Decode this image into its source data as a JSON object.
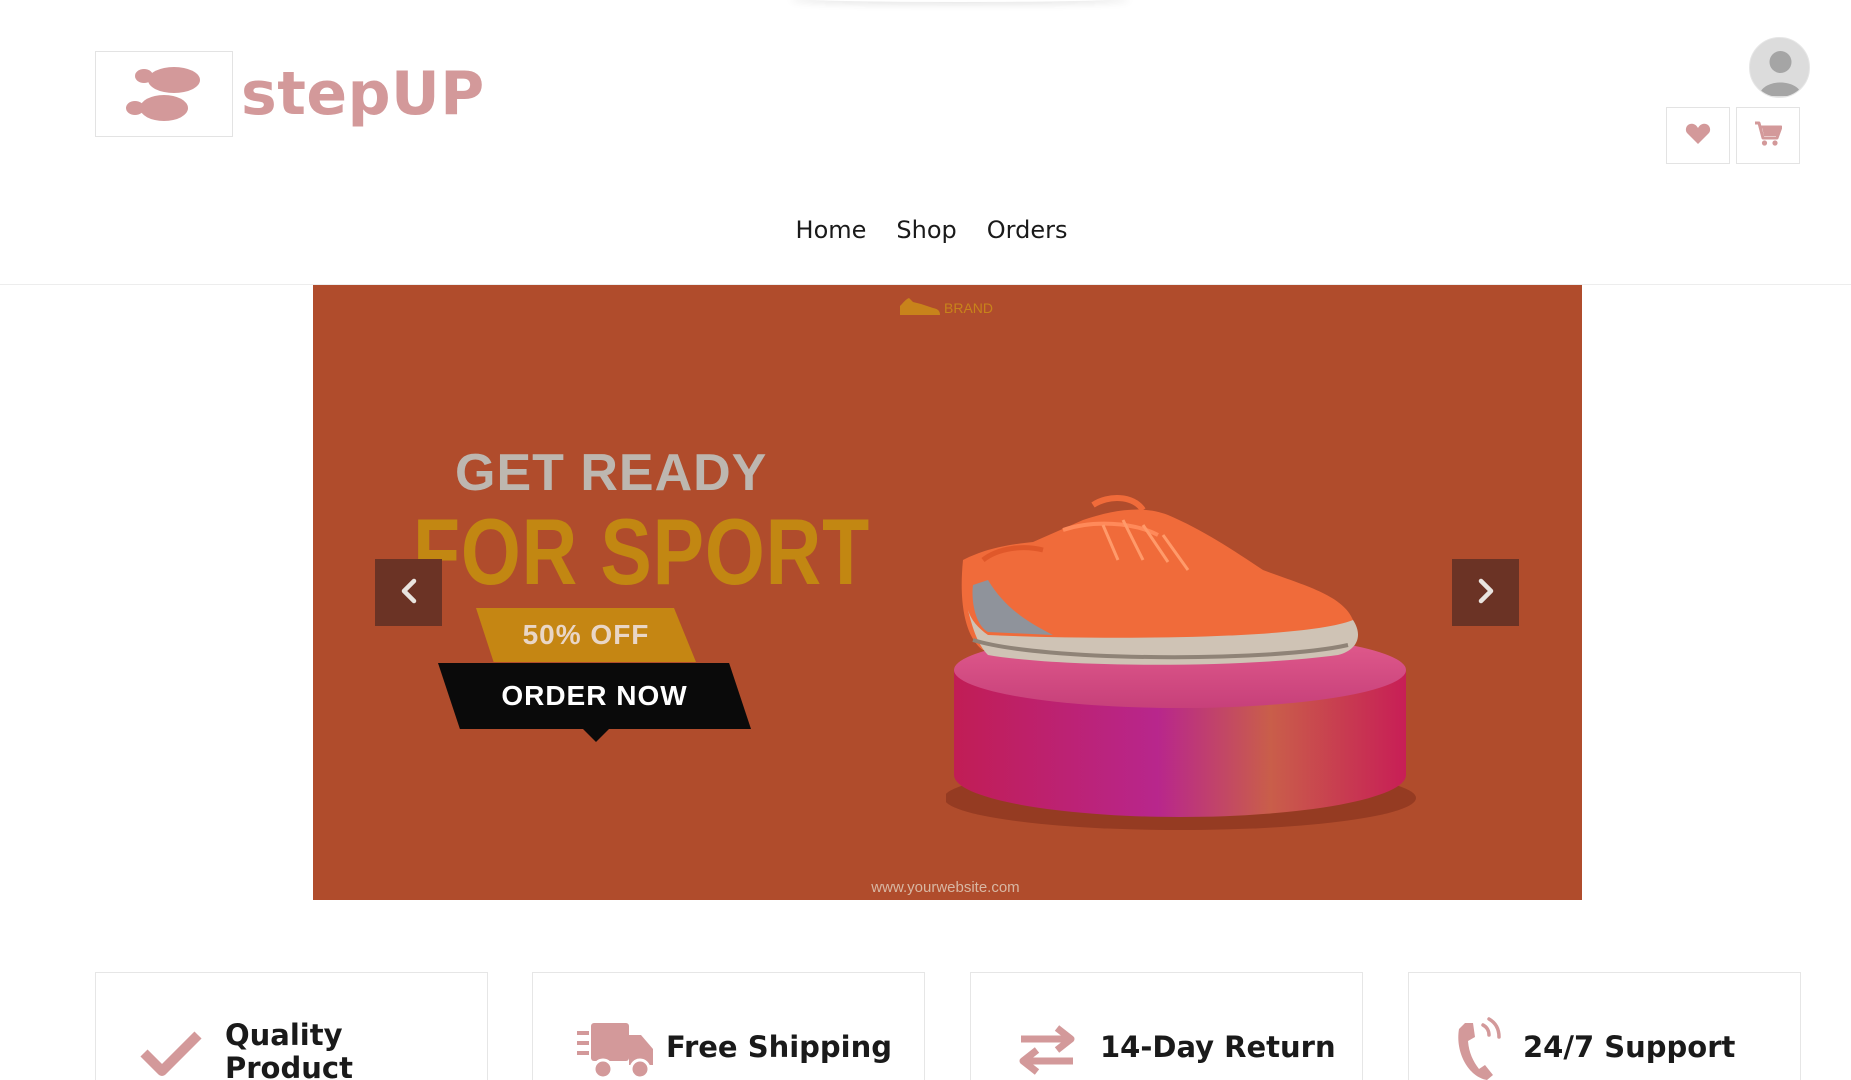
{
  "header": {
    "logo_text": "stepUP",
    "brand_color": "#d3999a",
    "avatar_icon": "user-avatar-icon",
    "wishlist_icon": "heart-icon",
    "cart_icon": "cart-icon"
  },
  "nav": {
    "items": [
      {
        "label": "Home"
      },
      {
        "label": "Shop"
      },
      {
        "label": "Orders"
      }
    ]
  },
  "carousel": {
    "slide": {
      "brand": "BRAND",
      "line1": "GET READY",
      "line2": "FOR SPORT",
      "discount": "50% OFF",
      "cta": "ORDER NOW",
      "website": "www.yourwebsite.com",
      "background_color": "#b04c2c"
    },
    "prev_icon": "chevron-left-icon",
    "next_icon": "chevron-right-icon"
  },
  "features": [
    {
      "label": "Quality Product",
      "icon": "checkmark-icon"
    },
    {
      "label": "Free Shipping",
      "icon": "truck-icon"
    },
    {
      "label": "14-Day Return",
      "icon": "exchange-icon"
    },
    {
      "label": "24/7 Support",
      "icon": "phone-icon"
    }
  ]
}
